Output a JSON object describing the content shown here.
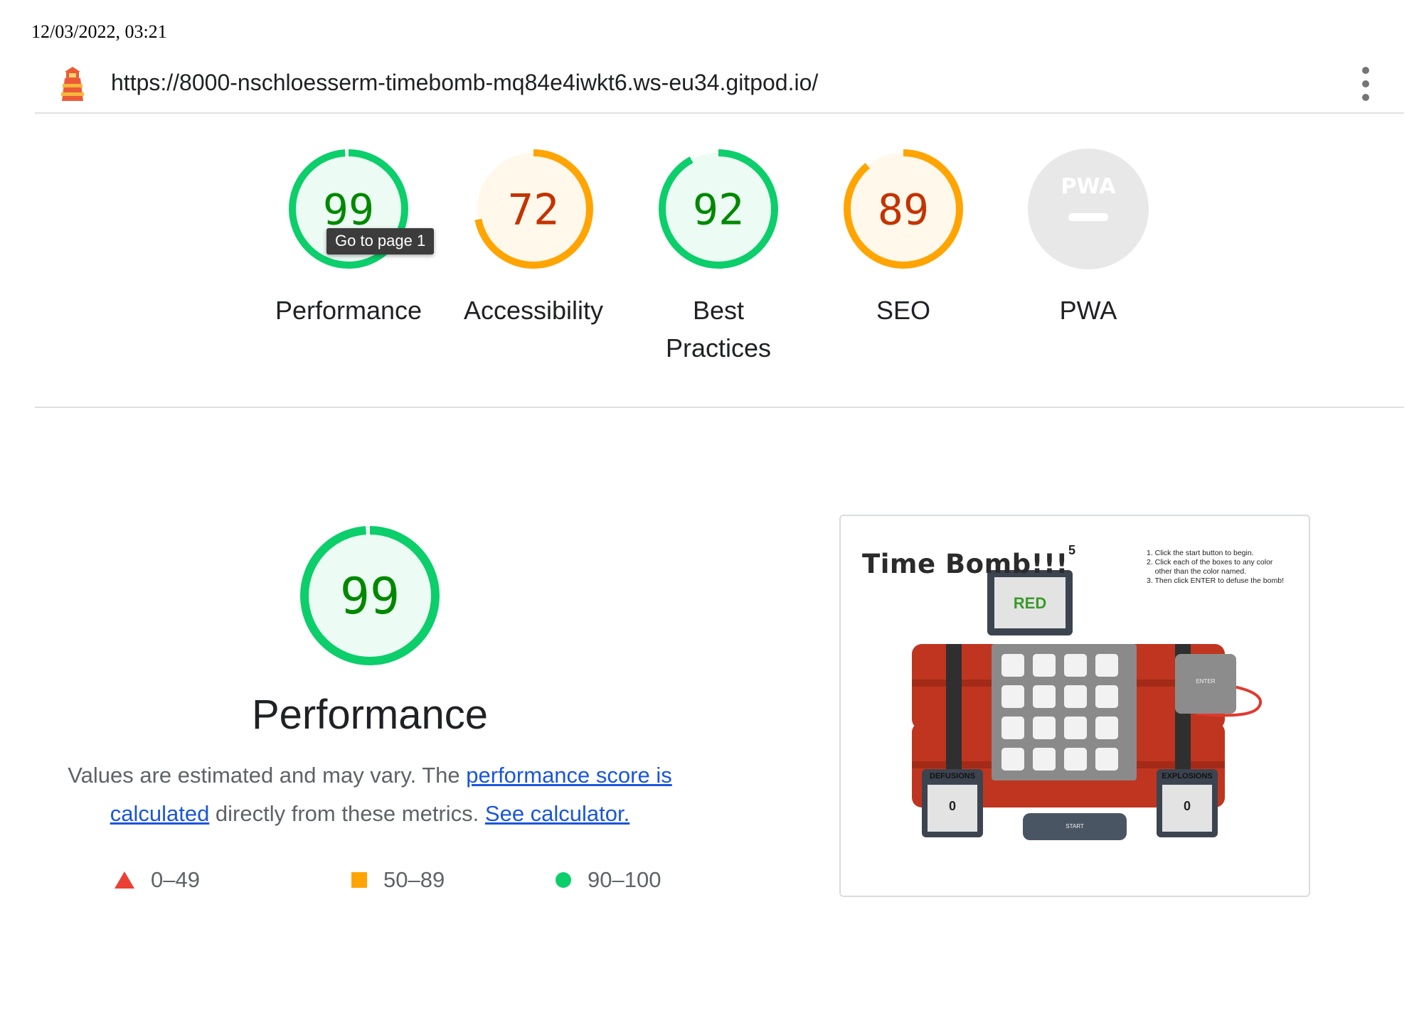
{
  "timestamp": "12/03/2022, 03:21",
  "header": {
    "url": "https://8000-nschloesserm-timebomb-mq84e4iwkt6.ws-eu34.gitpod.io/",
    "logo_icon": "lighthouse-icon",
    "menu_icon": "kebab-menu-icon"
  },
  "gauges": [
    {
      "label": "Performance",
      "score": "99",
      "value": 99,
      "status": "pass"
    },
    {
      "label": "Accessibility",
      "score": "72",
      "value": 72,
      "status": "average"
    },
    {
      "label": "Best Practices",
      "score": "92",
      "value": 92,
      "status": "pass"
    },
    {
      "label": "SEO",
      "score": "89",
      "value": 89,
      "status": "average"
    },
    {
      "label": "PWA",
      "score": "",
      "value": null,
      "status": "na",
      "badge": "PWA"
    }
  ],
  "tooltip": "Go to page 1",
  "performance": {
    "score": "99",
    "value": 99,
    "title": "Performance",
    "desc_before": "Values are estimated and may vary. The ",
    "link_score": "performance score is calculated",
    "desc_middle": " directly from these metrics. ",
    "link_calc": "See calculator.",
    "legend": [
      {
        "range": "0–49",
        "shape": "triangle",
        "color": "#eb4034"
      },
      {
        "range": "50–89",
        "shape": "square",
        "color": "#ffa400"
      },
      {
        "range": "90–100",
        "shape": "circle",
        "color": "#0cce6b"
      }
    ]
  },
  "screenshot": {
    "title": "Time Bomb!!!",
    "counter": "5",
    "instructions": "1. Click the start button to begin.\n2. Click each of the boxes to any color\n    other than the color named.\n3. Then click ENTER to defuse the bomb!",
    "color_word": "RED",
    "enter_label": "ENTER",
    "start_label": "START",
    "defusions_label": "DEFUSIONS",
    "defusions_value": "0",
    "explosions_label": "EXPLOSIONS",
    "explosions_value": "0"
  },
  "colors": {
    "pass": "#0cce6b",
    "pass_text": "#008800",
    "average": "#ffa400",
    "average_text": "#c33300",
    "na": "#e8e8e8",
    "link": "#1a56db"
  }
}
